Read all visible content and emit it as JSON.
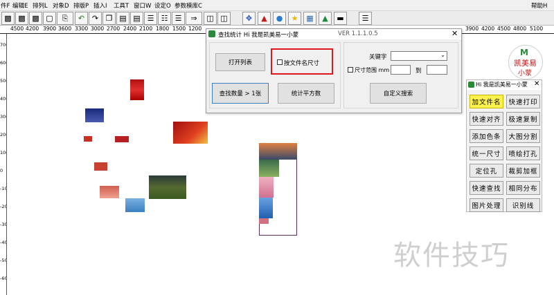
{
  "menu": [
    "件F",
    "编辑E",
    "排列L",
    "对象D",
    "排版P",
    "插入I",
    "工具T",
    "窗口W",
    "设定O",
    "参数模库C"
  ],
  "help_menu": "帮助H",
  "ruler_h_labels": [
    "4500",
    "4200",
    "3900",
    "3600",
    "3300",
    "3000",
    "2700",
    "2400",
    "2100",
    "1800",
    "1500",
    "1200",
    "3900",
    "3600",
    "3900",
    "4200",
    "4500",
    "4800",
    "5100"
  ],
  "ruler_v_labels": [
    "700",
    "600",
    "500",
    "400",
    "300",
    "200",
    "100",
    "0",
    "-100",
    "-200",
    "-300",
    "-400",
    "-500",
    "-600"
  ],
  "toolbar_icons": [
    "save-icon",
    "save-as-icon",
    "print-icon",
    "print-preview-icon",
    "undo-icon",
    "redo-icon",
    "copy-icon",
    "paste-icon",
    "align-left-icon",
    "distribute-icon",
    "align-right-icon",
    "group-icon",
    "split-icon",
    "move-icon",
    "color-tool-icon",
    "palette-icon",
    "star-icon",
    "map-icon",
    "gradient-icon",
    "ruler-tool-icon",
    "export-icon"
  ],
  "dialog": {
    "title": "查找统计 Hi 我是凯美易一小蒙",
    "version": "VER 1.1.1.0.5",
    "open_list": "打开列表",
    "by_filename_size": "按文件名尺寸",
    "find_count": "查找数量 > 1张",
    "stat_area": "统计平方数",
    "keyword_label": "关键字",
    "keyword_value": "",
    "size_range_label": "尺寸范围 mm",
    "range_to": "到",
    "custom_search": "自定义搜索"
  },
  "logo": {
    "text": "凯美易",
    "subtext": "小蒙"
  },
  "panel": {
    "title": "Hi 我是凯美易一小蒙",
    "buttons": [
      "加文件名",
      "快速打印",
      "快速对齐",
      "极速复制",
      "添加色条",
      "大图分割",
      "统一尺寸",
      "喷绘打孔",
      "定位孔",
      "裁剪加框",
      "快速查找",
      "相同分布",
      "图片处理",
      "识别线"
    ]
  },
  "watermark": "软件技巧",
  "colors": {
    "highlight_red": "#e0141b",
    "active_yellow": "#fdf24c",
    "focus_blue": "#3c7fc1"
  }
}
